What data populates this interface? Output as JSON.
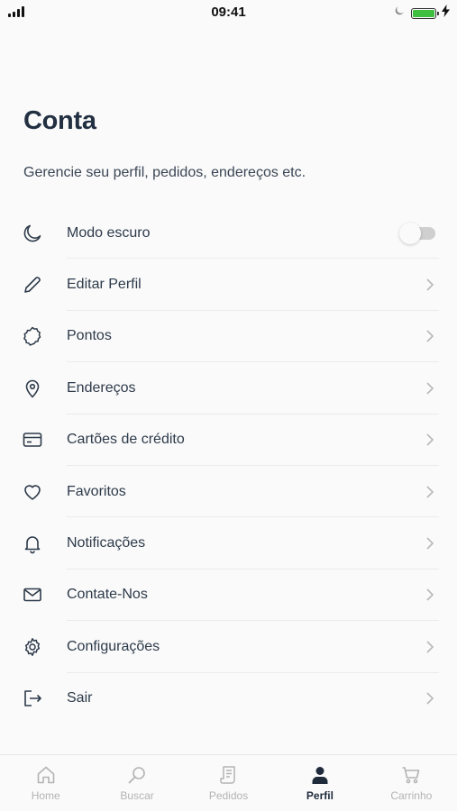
{
  "status_bar": {
    "time": "09:41"
  },
  "header": {
    "title": "Conta",
    "subtitle": "Gerencie seu perfil, pedidos, endereços etc."
  },
  "menu": {
    "dark_mode": {
      "label": "Modo escuro",
      "enabled": false
    },
    "items": [
      {
        "label": "Editar Perfil",
        "icon": "pencil-icon"
      },
      {
        "label": "Pontos",
        "icon": "badge-icon"
      },
      {
        "label": "Endereços",
        "icon": "map-pin-icon"
      },
      {
        "label": "Cartões de crédito",
        "icon": "credit-card-icon"
      },
      {
        "label": "Favoritos",
        "icon": "heart-icon"
      },
      {
        "label": "Notificações",
        "icon": "bell-icon"
      },
      {
        "label": "Contate-Nos",
        "icon": "mail-icon"
      },
      {
        "label": "Configurações",
        "icon": "gear-icon"
      },
      {
        "label": "Sair",
        "icon": "logout-icon"
      }
    ]
  },
  "tabbar": {
    "tabs": [
      {
        "label": "Home",
        "icon": "home-icon"
      },
      {
        "label": "Buscar",
        "icon": "search-icon"
      },
      {
        "label": "Pedidos",
        "icon": "receipt-icon"
      },
      {
        "label": "Perfil",
        "icon": "user-icon",
        "active": true
      },
      {
        "label": "Carrinho",
        "icon": "cart-icon"
      }
    ]
  },
  "colors": {
    "background": "#fafafa",
    "title": "#223042",
    "text": "#2d3a4a",
    "tab_active": "#1f2b3b",
    "tab_inactive": "#b3b3b3",
    "battery": "#3fbf3f"
  }
}
